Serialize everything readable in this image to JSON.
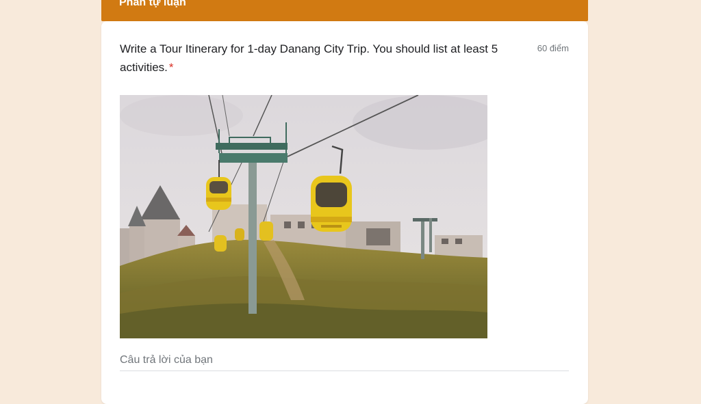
{
  "section": {
    "title": "Phần tự luận",
    "header_color": "#d17a12"
  },
  "question": {
    "text": "Write a Tour Itinerary for 1-day Danang City Trip. You should list at least 5 activities.",
    "required_mark": "*",
    "points": "60 điểm"
  },
  "image": {
    "subject": "cable cars over hillside castle"
  },
  "answer": {
    "placeholder": "Câu trả lời của bạn"
  }
}
